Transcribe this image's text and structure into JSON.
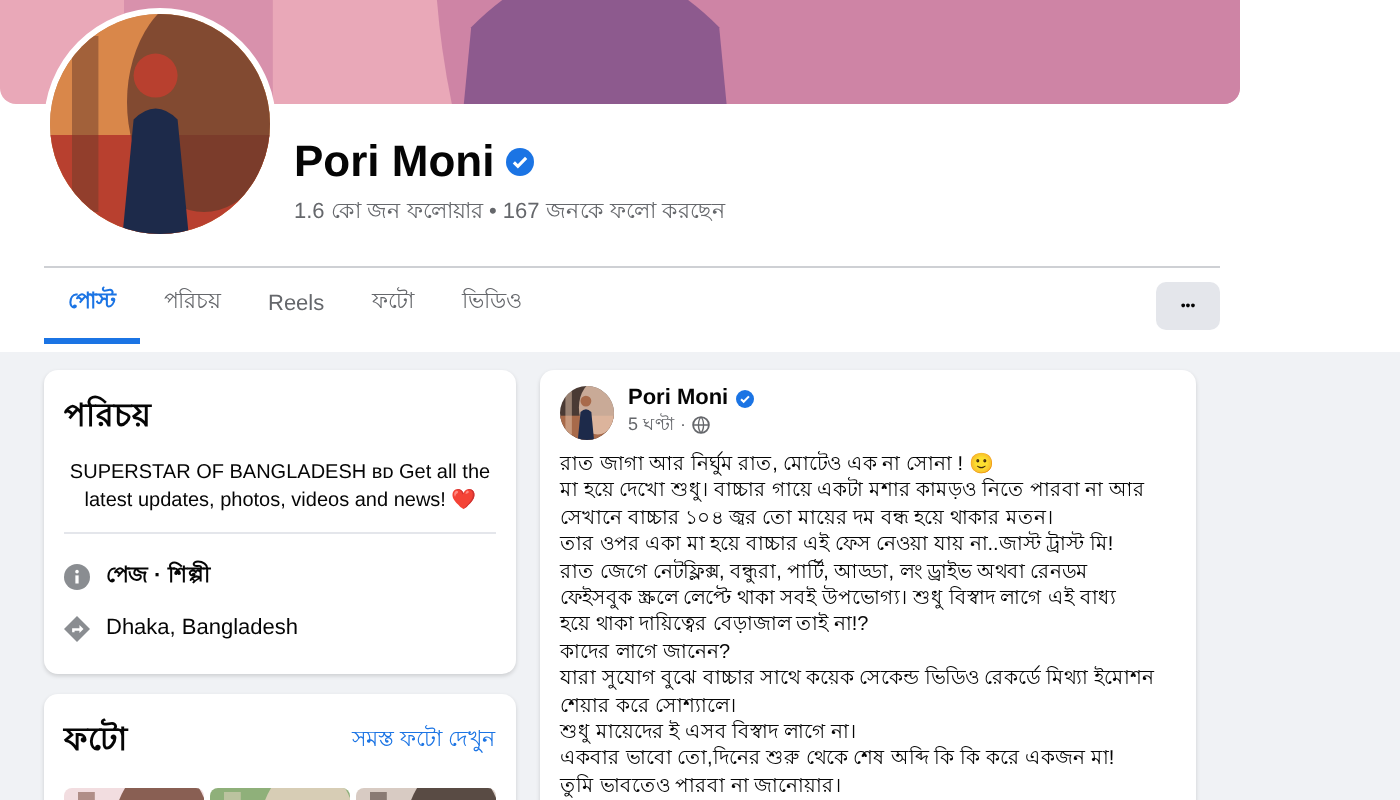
{
  "profile": {
    "name": "Pori Moni",
    "verified": true,
    "stats": "1.6 কো জন ফলোয়ার • 167 জনকে ফলো করছেন"
  },
  "tabs": [
    {
      "label": "পোস্ট",
      "selected": true
    },
    {
      "label": "পরিচয়",
      "selected": false
    },
    {
      "label": "Reels",
      "selected": false
    },
    {
      "label": "ফটো",
      "selected": false
    },
    {
      "label": "ভিডিও",
      "selected": false
    }
  ],
  "more_button": {
    "label": "•••"
  },
  "intro": {
    "title": "পরিচয়",
    "bio": "SUPERSTAR OF BANGLADESH ʙᴅ Get all the latest updates, photos, videos and news! ❤️",
    "details": [
      {
        "kind": "info",
        "text": "পেজ · শিল্পী"
      },
      {
        "kind": "location",
        "text": "Dhaka, Bangladesh"
      }
    ]
  },
  "photos": {
    "title": "ফটো",
    "link": "সমস্ত ফটো দেখুন"
  },
  "post": {
    "author": "Pori Moni",
    "verified": true,
    "time": "5 ঘণ্টা ·",
    "lines": [
      "রাত জাগা আর নির্ঘুম রাত, মোটেও এক না সোনা ! 🙂",
      "মা হয়ে দেখো শুধু। বাচ্চার গায়ে একটা মশার কামড়ও নিতে পারবা না আর",
      "সেখানে বাচ্চার ১০৪ জ্বর তো মায়ের দম বন্ধ হয়ে থাকার মতন।",
      "তার ওপর একা মা হয়ে বাচ্চার এই ফেস নেওয়া যায় না..জাস্ট ট্রাস্ট মি!",
      "রাত জেগে নেটফ্লিক্স, বন্ধুরা, পার্টি, আড্ডা, লং ড্রাইভ অথবা রেনডম",
      "ফেইসবুক স্ক্রলে লেপ্টে থাকা সবই উপভোগ্য। শুধু বিস্বাদ লাগে এই বাধ্য",
      "হয়ে থাকা দায়িত্বের বেড়াজাল তাই না!?",
      "কাদের লাগে জানেন?",
      "যারা সুযোগ বুঝে বাচ্চার সাথে কয়েক সেকেন্ড ভিডিও রেকর্ডে মিথ্যা ইমোশন",
      "শেয়ার করে সোশ্যালে।",
      "শুধু মায়েদের ই এসব বিস্বাদ লাগে না।",
      "একবার ভাবো তো,দিনের শুরু থেকে শেষ অব্দি কি কি করে একজন মা!",
      "তুমি ভাবতেও পারবা না জানোয়ার।"
    ]
  }
}
